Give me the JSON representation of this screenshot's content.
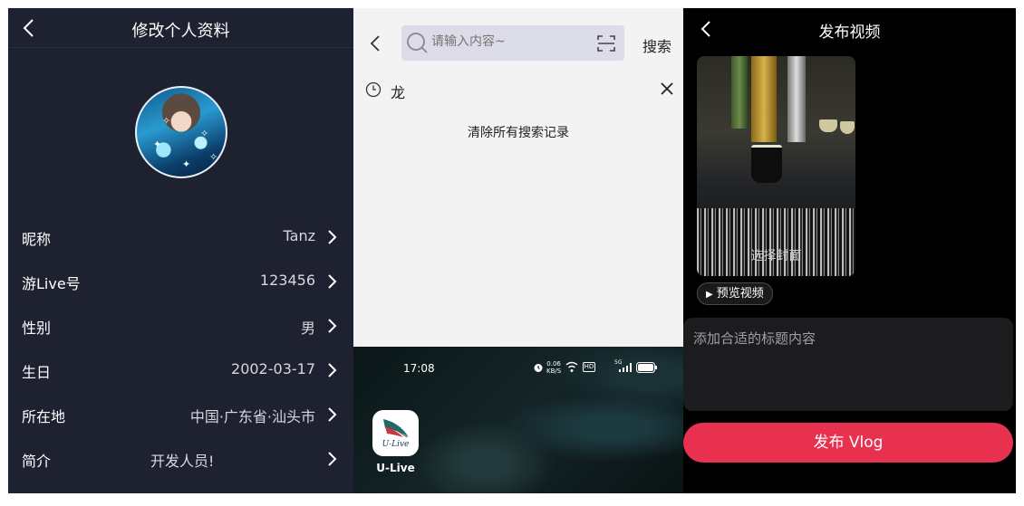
{
  "colors": {
    "profile_bg": "#1e2130",
    "search_bg": "#f3f3f3",
    "video_bg": "#000000",
    "accent": "#e8314f"
  },
  "profile": {
    "title": "修改个人资料",
    "rows": [
      {
        "label": "昵称",
        "value": "Tanz"
      },
      {
        "label": "游Live号",
        "value": "123456"
      },
      {
        "label": "性别",
        "value": "男"
      },
      {
        "label": "生日",
        "value": "2002-03-17"
      },
      {
        "label": "所在地",
        "value": "中国·广东省·汕头市"
      },
      {
        "label": "简介",
        "value": "开发人员!"
      }
    ]
  },
  "search": {
    "placeholder": "请输入内容~",
    "button": "搜索",
    "history": [
      {
        "text": "龙"
      }
    ],
    "clear_all": "清除所有搜索记录"
  },
  "homescreen": {
    "time": "17:08",
    "net_speed": "0.06",
    "net_unit": "KB/S",
    "hd_badge": "HD",
    "signal_label": "5G",
    "app_name": "U-Live",
    "app_icon_text": "U-Live"
  },
  "publish": {
    "title": "发布视频",
    "cover_label": "选择封面",
    "preview_label": "预览视频",
    "placeholder": "添加合适的标题内容",
    "button": "发布 Vlog"
  }
}
